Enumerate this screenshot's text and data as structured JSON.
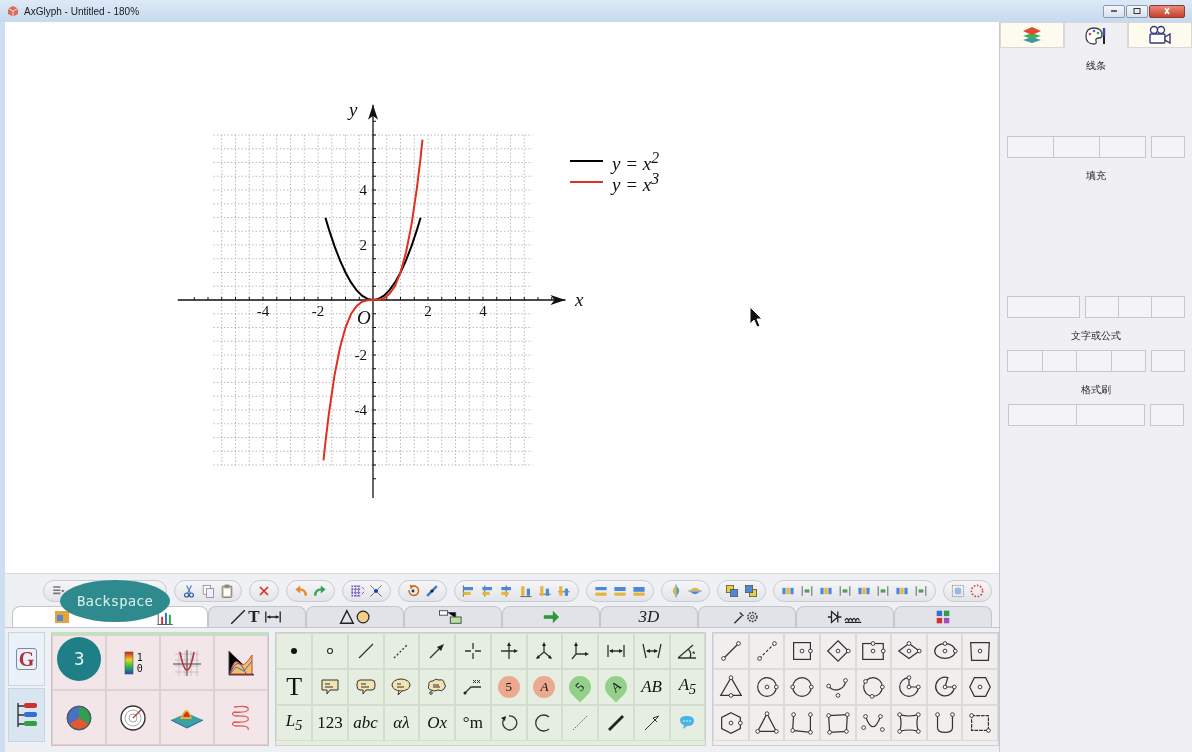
{
  "window": {
    "title": "AxGlyph - Untitled - 180%"
  },
  "canvas": {
    "origin_label": "O",
    "chart_data": {
      "type": "line",
      "xlabel": "x",
      "ylabel": "y",
      "x": [
        -1.8,
        -1.73,
        -1.6,
        -1.4,
        -1.2,
        -1,
        -0.8,
        -0.6,
        -0.4,
        -0.2,
        0,
        0.2,
        0.4,
        0.6,
        0.8,
        1,
        1.2,
        1.4,
        1.6,
        1.73,
        1.8
      ],
      "series": [
        {
          "name": "y = x$^{2}$",
          "color": "#000000",
          "values": [
            null,
            2.99,
            2.56,
            1.96,
            1.44,
            1,
            0.64,
            0.36,
            0.16,
            0.04,
            0,
            0.04,
            0.16,
            0.36,
            0.64,
            1,
            1.44,
            1.96,
            2.56,
            2.99,
            null
          ]
        },
        {
          "name": "y = x$^{3}$",
          "color": "#e0301e",
          "values": [
            -5.83,
            -5.18,
            -4.1,
            -2.74,
            -1.73,
            -1,
            -0.51,
            -0.22,
            -0.06,
            -0.01,
            0,
            0.01,
            0.06,
            0.22,
            0.51,
            1,
            1.73,
            2.74,
            4.1,
            5.18,
            5.83
          ]
        }
      ],
      "xlim": [
        -7.1,
        7
      ],
      "ylim": [
        -7.2,
        7.1
      ],
      "grid": true,
      "legend": true,
      "xticks": [
        -4,
        -2,
        2,
        4
      ],
      "yticks": [
        -4,
        -2,
        2,
        4
      ]
    }
  },
  "overlays": {
    "keystroke": "Backspace",
    "click_count": "3"
  },
  "toolbar_tabs": [
    {
      "selected": true
    },
    {
      "selected": false,
      "label": "T"
    },
    {
      "selected": false
    },
    {
      "selected": false
    },
    {
      "selected": false
    },
    {
      "selected": false,
      "label": "3D"
    },
    {
      "selected": false
    },
    {
      "selected": false
    },
    {
      "selected": false
    }
  ],
  "side_tabs": [
    {
      "label": "G",
      "selected": true
    },
    {
      "selected": false
    }
  ],
  "chart_palette": {
    "colorbar_labels": [
      "1",
      "0"
    ]
  },
  "symbol_tools": [
    {
      "label": "T",
      "kind": "large",
      "italic": false
    },
    {
      "label": "5",
      "kind": "badge",
      "italic": false
    },
    {
      "label": "A",
      "kind": "badge",
      "italic": true
    },
    {
      "label": "5",
      "kind": "pin",
      "italic": false
    },
    {
      "label": "A",
      "kind": "pin",
      "italic": true
    },
    {
      "label": "AB",
      "kind": "plain",
      "italic": true
    },
    {
      "label": "A$_{5}$",
      "kind": "plain",
      "italic": true
    },
    {
      "label": "L$_{5}$",
      "kind": "plain",
      "italic": true
    },
    {
      "label": "123",
      "kind": "plain",
      "italic": false
    },
    {
      "label": "abc",
      "kind": "plain",
      "italic": true
    },
    {
      "label": "αλ",
      "kind": "plain",
      "italic": true
    },
    {
      "label": "Ox",
      "kind": "plain",
      "italic": true
    },
    {
      "label": "°m",
      "kind": "plain",
      "italic": false
    }
  ],
  "inspector": {
    "tabs": [
      {
        "selected": false
      },
      {
        "selected": true
      },
      {
        "selected": false
      }
    ],
    "sections": [
      {
        "label": "线条"
      },
      {
        "label": "填充"
      },
      {
        "label": "文字或公式"
      },
      {
        "label": "格式刷"
      }
    ]
  }
}
